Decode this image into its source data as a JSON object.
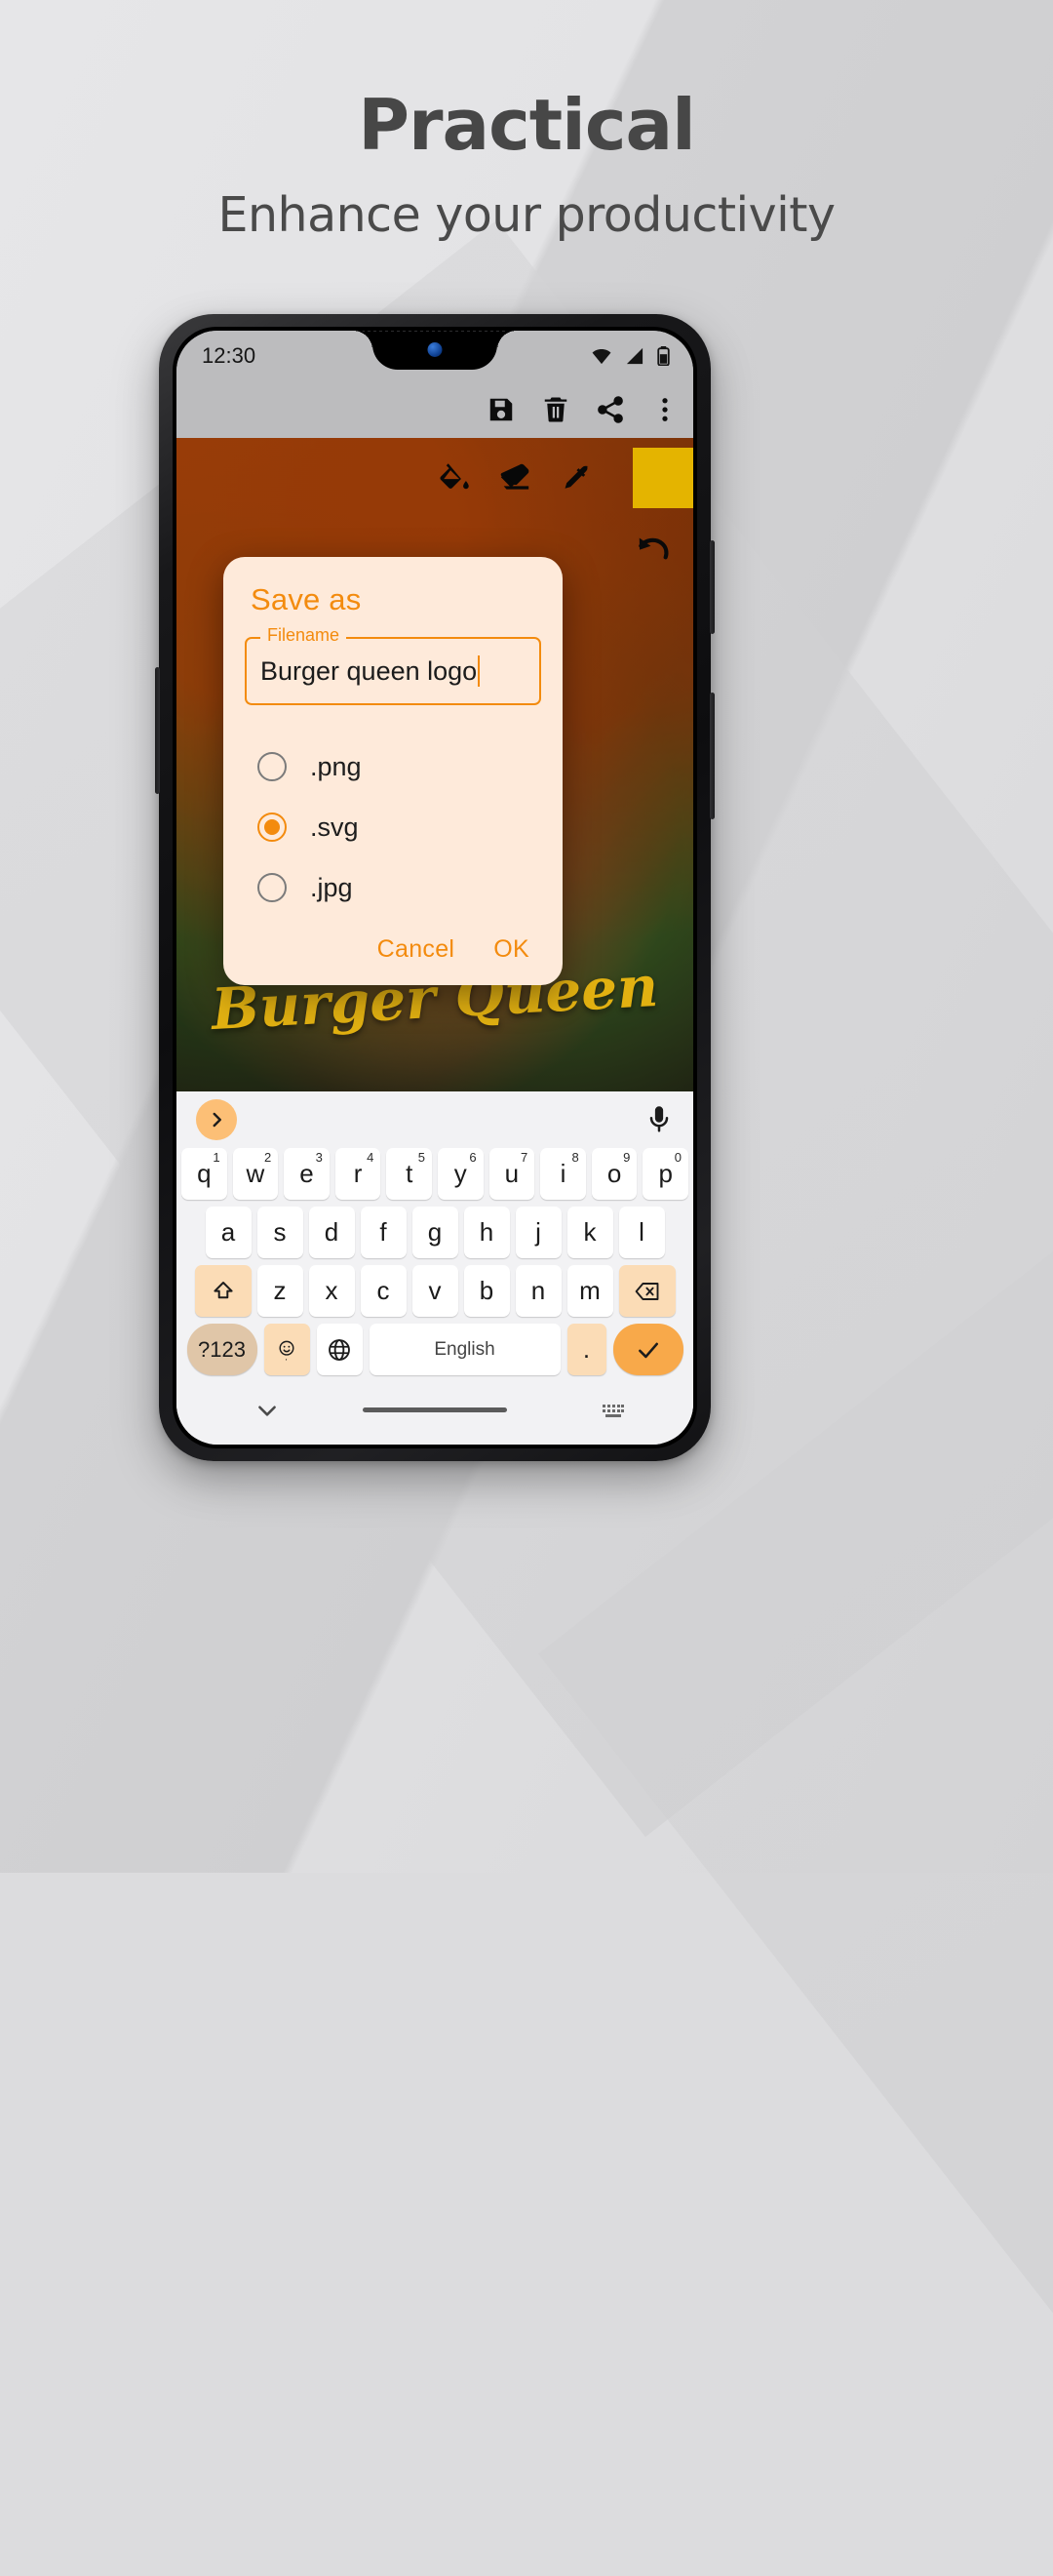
{
  "promo": {
    "headline": "Practical",
    "subheadline": "Enhance your productivity"
  },
  "colors": {
    "accent": "#ef8c15",
    "dialog_bg": "#fdeadb",
    "swatch": "#e2b400",
    "key_accent": "#f8a94a",
    "logo_text": "#e0b119"
  },
  "phone": {
    "status_bar": {
      "clock": "12:30",
      "icons": [
        "wifi-icon",
        "signal-icon",
        "battery-icon"
      ]
    },
    "app_bar": {
      "actions": [
        {
          "name": "save-icon",
          "label": "Save"
        },
        {
          "name": "delete-icon",
          "label": "Delete"
        },
        {
          "name": "share-icon",
          "label": "Share"
        },
        {
          "name": "overflow-menu-icon",
          "label": "More options"
        }
      ]
    },
    "canvas": {
      "tools": [
        {
          "name": "fill-bucket-icon",
          "label": "Fill"
        },
        {
          "name": "eraser-icon",
          "label": "Eraser"
        },
        {
          "name": "eyedropper-icon",
          "label": "Color picker"
        }
      ],
      "current_color": "#e2b400",
      "undo_label": "Undo",
      "artwork_text": "Burger Queen"
    },
    "dialog": {
      "title": "Save as",
      "field_label": "Filename",
      "field_value": "Burger queen logo",
      "options": [
        {
          "label": ".png",
          "selected": false
        },
        {
          "label": ".svg",
          "selected": true
        },
        {
          "label": ".jpg",
          "selected": false
        }
      ],
      "cancel_label": "Cancel",
      "ok_label": "OK"
    },
    "keyboard": {
      "expand_icon": "chevron-right-icon",
      "mic_icon": "microphone-icon",
      "row1": [
        {
          "key": "q",
          "sup": "1"
        },
        {
          "key": "w",
          "sup": "2"
        },
        {
          "key": "e",
          "sup": "3"
        },
        {
          "key": "r",
          "sup": "4"
        },
        {
          "key": "t",
          "sup": "5"
        },
        {
          "key": "y",
          "sup": "6"
        },
        {
          "key": "u",
          "sup": "7"
        },
        {
          "key": "i",
          "sup": "8"
        },
        {
          "key": "o",
          "sup": "9"
        },
        {
          "key": "p",
          "sup": "0"
        }
      ],
      "row2": [
        "a",
        "s",
        "d",
        "f",
        "g",
        "h",
        "j",
        "k",
        "l"
      ],
      "row3_keys": [
        "z",
        "x",
        "c",
        "v",
        "b",
        "n",
        "m"
      ],
      "shift_icon": "shift-icon",
      "backspace_icon": "backspace-icon",
      "symbols_label": "?123",
      "emoji_label": ",",
      "emoji_icon": "emoji-icon",
      "globe_icon": "language-globe-icon",
      "space_label": "English",
      "period_label": ".",
      "enter_icon": "check-icon"
    },
    "nav_bar": {
      "down_icon": "chevron-down-icon",
      "home_pill": "home-indicator",
      "keyboard_icon": "keyboard-switch-icon"
    }
  }
}
